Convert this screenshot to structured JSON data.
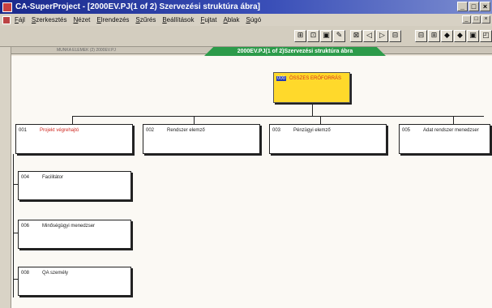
{
  "window": {
    "title": "CA-SuperProject - [2000EV.PJ(1 of 2) Szervezési struktúra ábra]",
    "controls": [
      "_",
      "□",
      "×"
    ]
  },
  "menu": {
    "items": [
      "Fájl",
      "Szerkesztés",
      "Nézet",
      "Elrendezés",
      "Szűrés",
      "Beállítások",
      "Fujtat",
      "Ablak",
      "Súgó"
    ],
    "mdi_controls": [
      "_",
      "□",
      "×"
    ]
  },
  "toolbar": {
    "group1": [
      "⊞",
      "⊡",
      "▣",
      "✎"
    ],
    "group2": [
      "⊠",
      "◁",
      "▷",
      "⊟"
    ],
    "group3": [
      "⊟",
      "⊞",
      "◆",
      "◆",
      "▣",
      "◰"
    ]
  },
  "ruler": {
    "text": "MUNKA ELEMEK (2) 2000EV.PJ"
  },
  "sheet_tab": {
    "label": "2000EV.PJ(1 of 2)Szervezési struktúra ábra"
  },
  "chart": {
    "root": {
      "code": "000",
      "label": "ÖSSZES ERŐFORRÁS"
    },
    "level1": [
      {
        "code": "001",
        "label": "Projekt végrehajtó"
      },
      {
        "code": "002",
        "label": "Rendszer elemző"
      },
      {
        "code": "003",
        "label": "Pénzügyi elemző"
      },
      {
        "code": "005",
        "label": "Adat rendszer menedzser"
      }
    ],
    "children": [
      {
        "code": "004",
        "label": "Facilitátor"
      },
      {
        "code": "006",
        "label": "Minőségügyi menedzser"
      },
      {
        "code": "008",
        "label": "QA személy"
      }
    ]
  }
}
